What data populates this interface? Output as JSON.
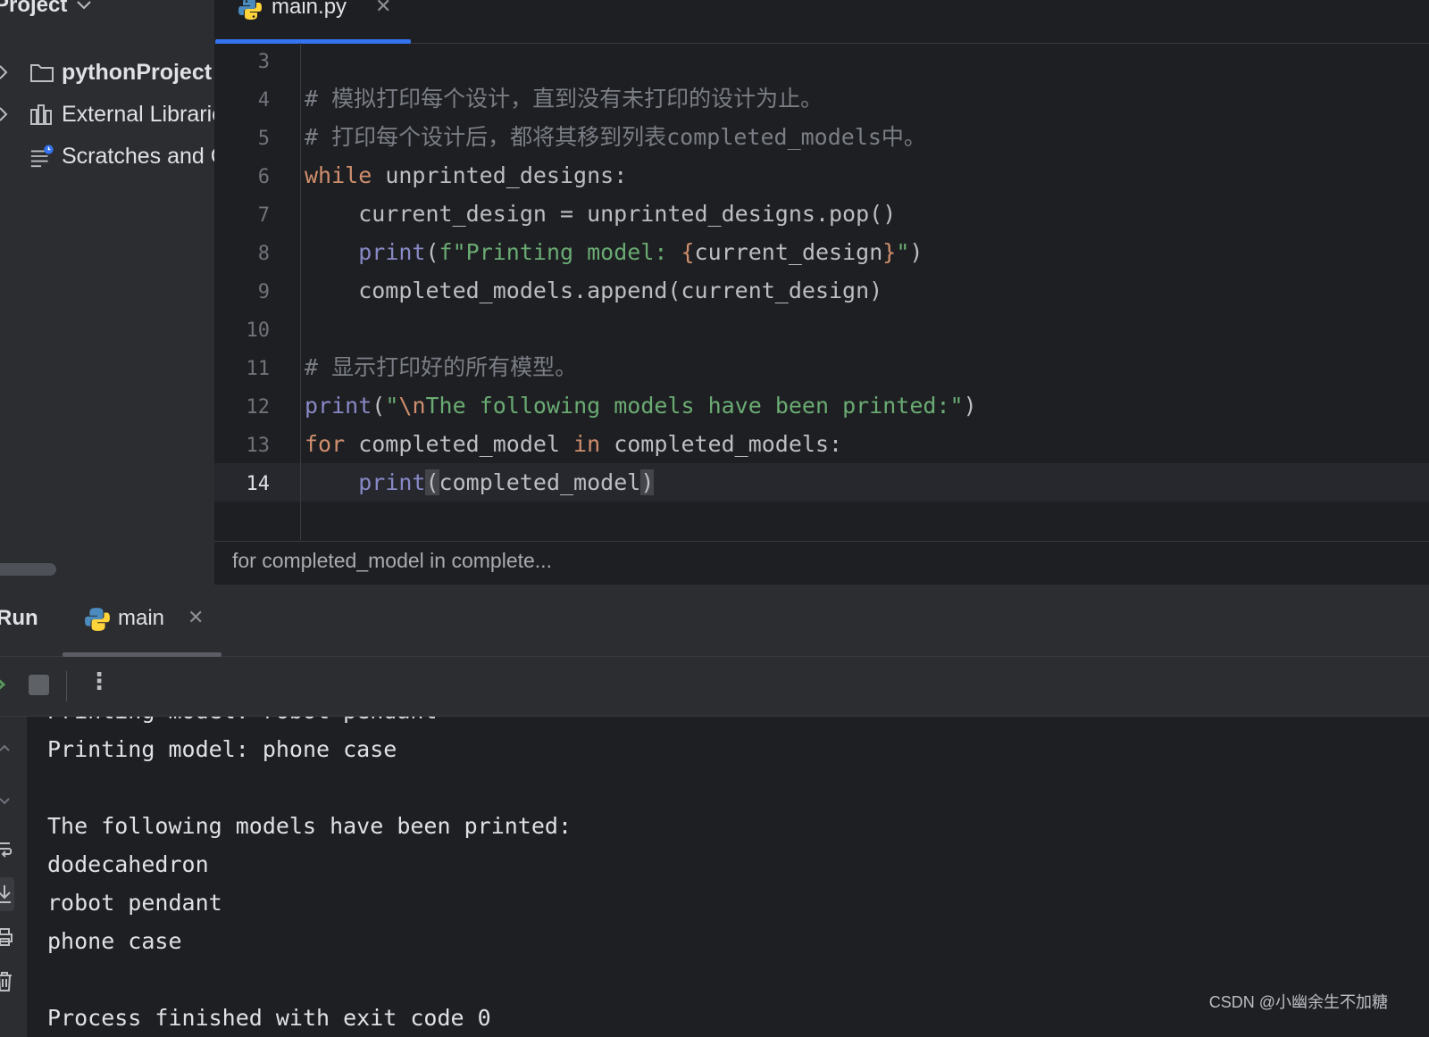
{
  "project": {
    "header": "Project",
    "tree": [
      {
        "label": "pythonProject",
        "bold": true
      },
      {
        "label": "External Libraries"
      },
      {
        "label": "Scratches and Consoles"
      }
    ]
  },
  "editor": {
    "tab_label": "main.py",
    "line_numbers": [
      "3",
      "4",
      "5",
      "6",
      "7",
      "8",
      "9",
      "10",
      "11",
      "12",
      "13",
      "14"
    ],
    "current_line": "14",
    "code": {
      "l4": "# 模拟打印每个设计，直到没有未打印的设计为止。",
      "l5": "# 打印每个设计后，都将其移到列表completed_models中。",
      "l6_kw": "while",
      "l6_rest": " unprinted_designs:",
      "l7": "    current_design = unprinted_designs.pop()",
      "l8_indent": "    ",
      "l8_fn": "print",
      "l8_open": "(",
      "l8_str1": "f\"Printing model: ",
      "l8_lbrace": "{",
      "l8_var": "current_design",
      "l8_rbrace": "}",
      "l8_str2": "\"",
      "l8_close": ")",
      "l9": "    completed_models.append(current_design)",
      "l11": "# 显示打印好的所有模型。",
      "l12_fn": "print",
      "l12_open": "(",
      "l12_q": "\"",
      "l12_esc": "\\n",
      "l12_str": "The following models have been printed:\"",
      "l12_close": ")",
      "l13_kw1": "for",
      "l13_mid": " completed_model ",
      "l13_kw2": "in",
      "l13_rest": " completed_models:",
      "l14_indent": "    ",
      "l14_fn": "print",
      "l14_open": "(",
      "l14_arg": "completed_model",
      "l14_close": ")"
    },
    "breadcrumb": "for completed_model in complete..."
  },
  "run": {
    "title": "Run",
    "tab_label": "main",
    "console_lines": [
      "Printing model: robot pendant",
      "Printing model: phone case",
      "",
      "The following models have been printed:",
      "dodecahedron",
      "robot pendant",
      "phone case",
      "",
      "Process finished with exit code 0"
    ]
  },
  "watermark": "CSDN @小幽余生不加糖",
  "colors": {
    "background": "#1e1f22",
    "panel": "#2b2d30",
    "keyword": "#cf8e6d",
    "builtin": "#8888c6",
    "string": "#6aab73",
    "comment": "#7a7e85",
    "accent": "#3574f0"
  }
}
